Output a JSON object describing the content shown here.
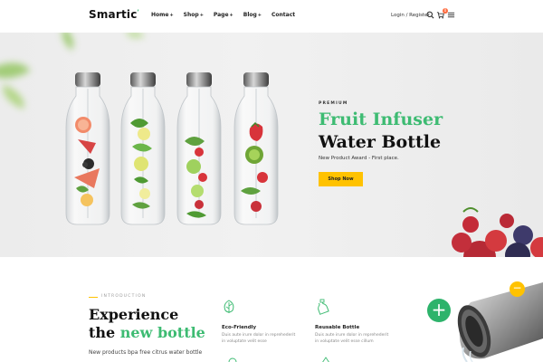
{
  "brand": {
    "logo": "Smartic",
    "logo_mark": "’"
  },
  "nav": {
    "items": [
      {
        "label": "Home",
        "caret": "+"
      },
      {
        "label": "Shop",
        "caret": "+"
      },
      {
        "label": "Page",
        "caret": "+"
      },
      {
        "label": "Blog",
        "caret": "+"
      },
      {
        "label": "Contact",
        "caret": ""
      }
    ],
    "login": "Login / Register",
    "cart_count": "0",
    "icons": [
      "search-icon",
      "cart-icon",
      "menu-icon"
    ]
  },
  "hero": {
    "eyebrow": "PREMIUM",
    "title_line1": "Fruit Infuser",
    "title_line2": "Water Bottle",
    "subtitle": "New Product Award - First place.",
    "cta": "Shop Now"
  },
  "intro": {
    "label": "INTRODUCTION",
    "heading_line1": "Experience",
    "heading_line2_a": "the ",
    "heading_line2_b": "new bottle",
    "body": "New products bpa free citrus water bottle",
    "features": [
      {
        "icon": "leaf-icon",
        "title": "Eco-Friendly",
        "text1": "Duis aute irure dolor in reprehederit",
        "text2": "in voluptate velit esse"
      },
      {
        "icon": "bottle-icon",
        "title": "Reusable Bottle",
        "text1": "Duis aute irure dolor in reprehederit",
        "text2": "in voluptate velit esse cillum"
      }
    ],
    "plus": "+",
    "minus": "−"
  },
  "colors": {
    "accent_green": "#3dbb72",
    "accent_yellow": "#ffc200",
    "badge": "#ff6a3d"
  }
}
